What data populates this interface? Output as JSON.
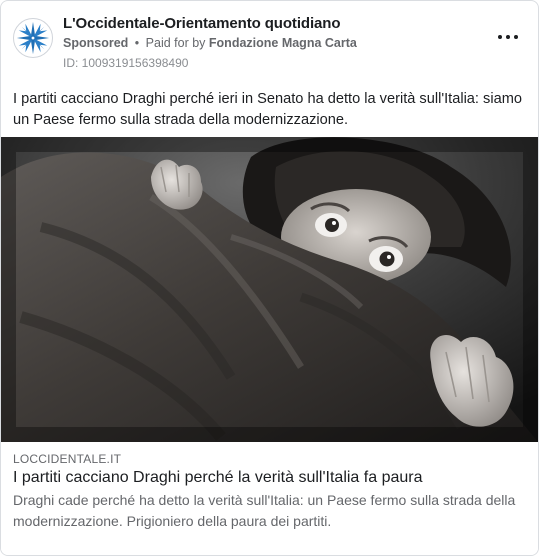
{
  "post": {
    "page_name": "L'Occidentale-Orientamento quotidiano",
    "sponsored_label": "Sponsored",
    "separator": "•",
    "paid_for_prefix": "Paid for by",
    "payer": "Fondazione Magna Carta",
    "ad_id": "ID: 1009319156398490",
    "body": "I partiti cacciano Draghi perché ieri in Senato ha detto la verità sull'Italia: siamo un Paese fermo sulla strada della modernizzazione.",
    "avatar_icon": "compass-rose-icon",
    "more_icon": "more-options-icon"
  },
  "link": {
    "domain": "LOCCIDENTALE.IT",
    "title": "I partiti cacciano Draghi perché la verità sull'Italia fa paura",
    "description": "Draghi cade perché ha detto la verità sull'Italia: un Paese fermo sulla strada della modernizzazione. Prigioniero della paura dei partiti."
  },
  "colors": {
    "logo_blue": "#1f6fb5",
    "secondary_text": "#65676b",
    "border": "#dadde1"
  }
}
